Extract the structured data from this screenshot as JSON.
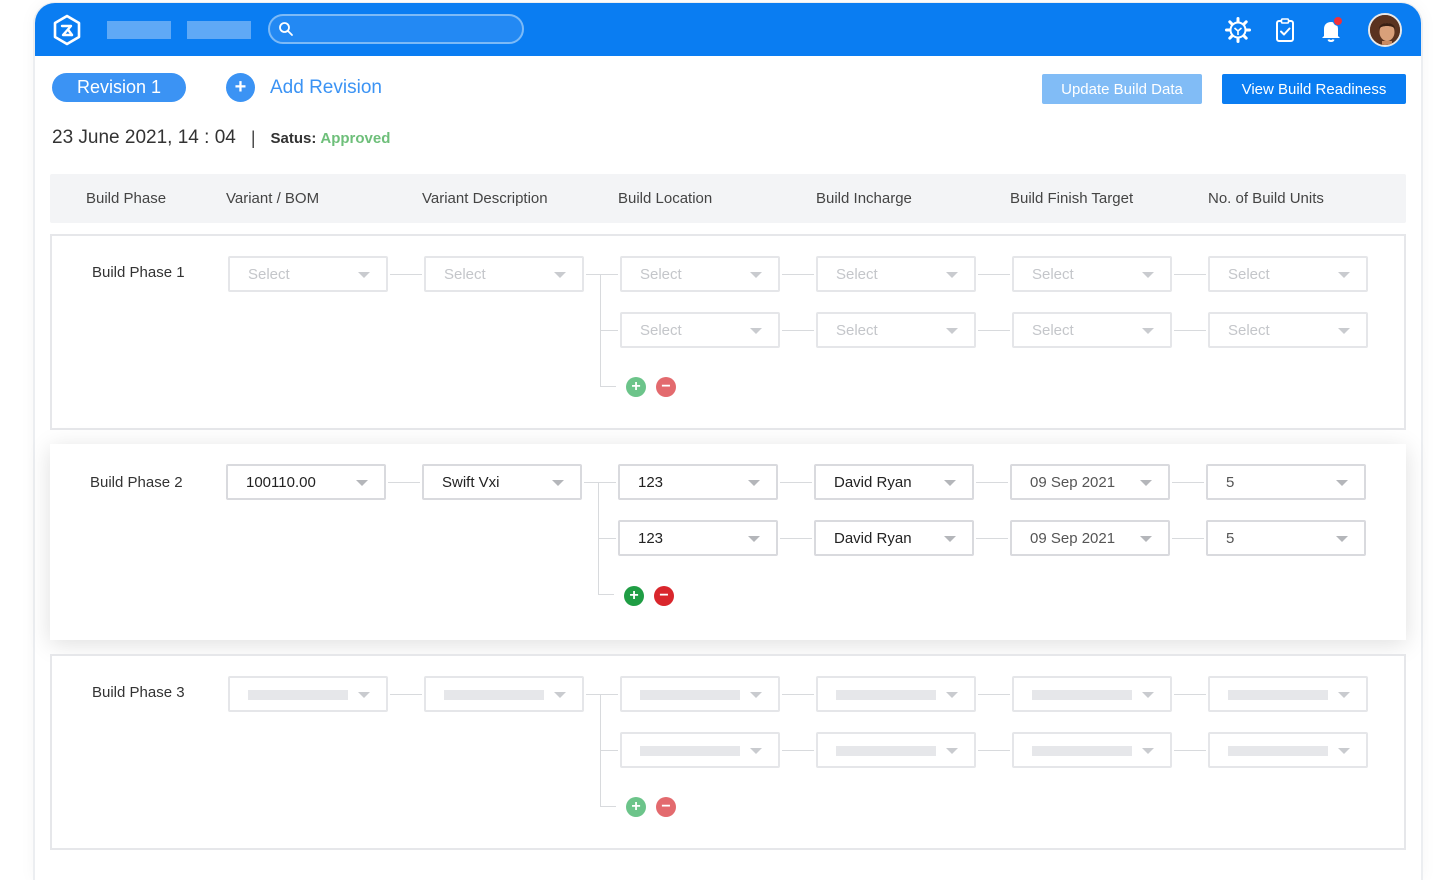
{
  "header": {
    "search_placeholder": "",
    "colors": {
      "bar": "#0a7df2",
      "accent": "#3b93f4",
      "approved": "#6ebf7a"
    },
    "icons": [
      "logo-icon",
      "search-icon",
      "gear-icon",
      "clipboard-check-icon",
      "bell-icon",
      "avatar"
    ]
  },
  "revision": {
    "tab_label": "Revision 1",
    "add_label": "Add Revision",
    "add_symbol": "+",
    "update_button": "Update Build Data",
    "view_button": "View Build Readiness",
    "date": "23 June 2021,  14 : 04",
    "separator": "|",
    "status_label": "Satus:",
    "status_value": "Approved"
  },
  "table": {
    "columns": [
      "Build Phase",
      "Variant / BOM",
      "Variant Description",
      "Build Location",
      "Build Incharge",
      "Build Finish Target",
      "No. of Build Units"
    ]
  },
  "controls": {
    "add_symbol": "+",
    "remove_symbol": "−"
  },
  "phases": [
    {
      "label": "Build Phase 1",
      "variant": "Select",
      "description": "Select",
      "rows": [
        {
          "location": "Select",
          "incharge": "Select",
          "target": "Select",
          "units": "Select"
        },
        {
          "location": "Select",
          "incharge": "Select",
          "target": "Select",
          "units": "Select"
        }
      ]
    },
    {
      "label": "Build Phase 2",
      "variant": "100110.00",
      "description": "Swift Vxi",
      "rows": [
        {
          "location": "123",
          "incharge": "David Ryan",
          "target": "09 Sep 2021",
          "units": "5"
        },
        {
          "location": "123",
          "incharge": "David Ryan",
          "target": "09 Sep 2021",
          "units": "5"
        }
      ]
    },
    {
      "label": "Build Phase 3",
      "variant": "",
      "description": "",
      "rows": [
        {
          "location": "",
          "incharge": "",
          "target": "",
          "units": ""
        },
        {
          "location": "",
          "incharge": "",
          "target": "",
          "units": ""
        }
      ]
    }
  ]
}
